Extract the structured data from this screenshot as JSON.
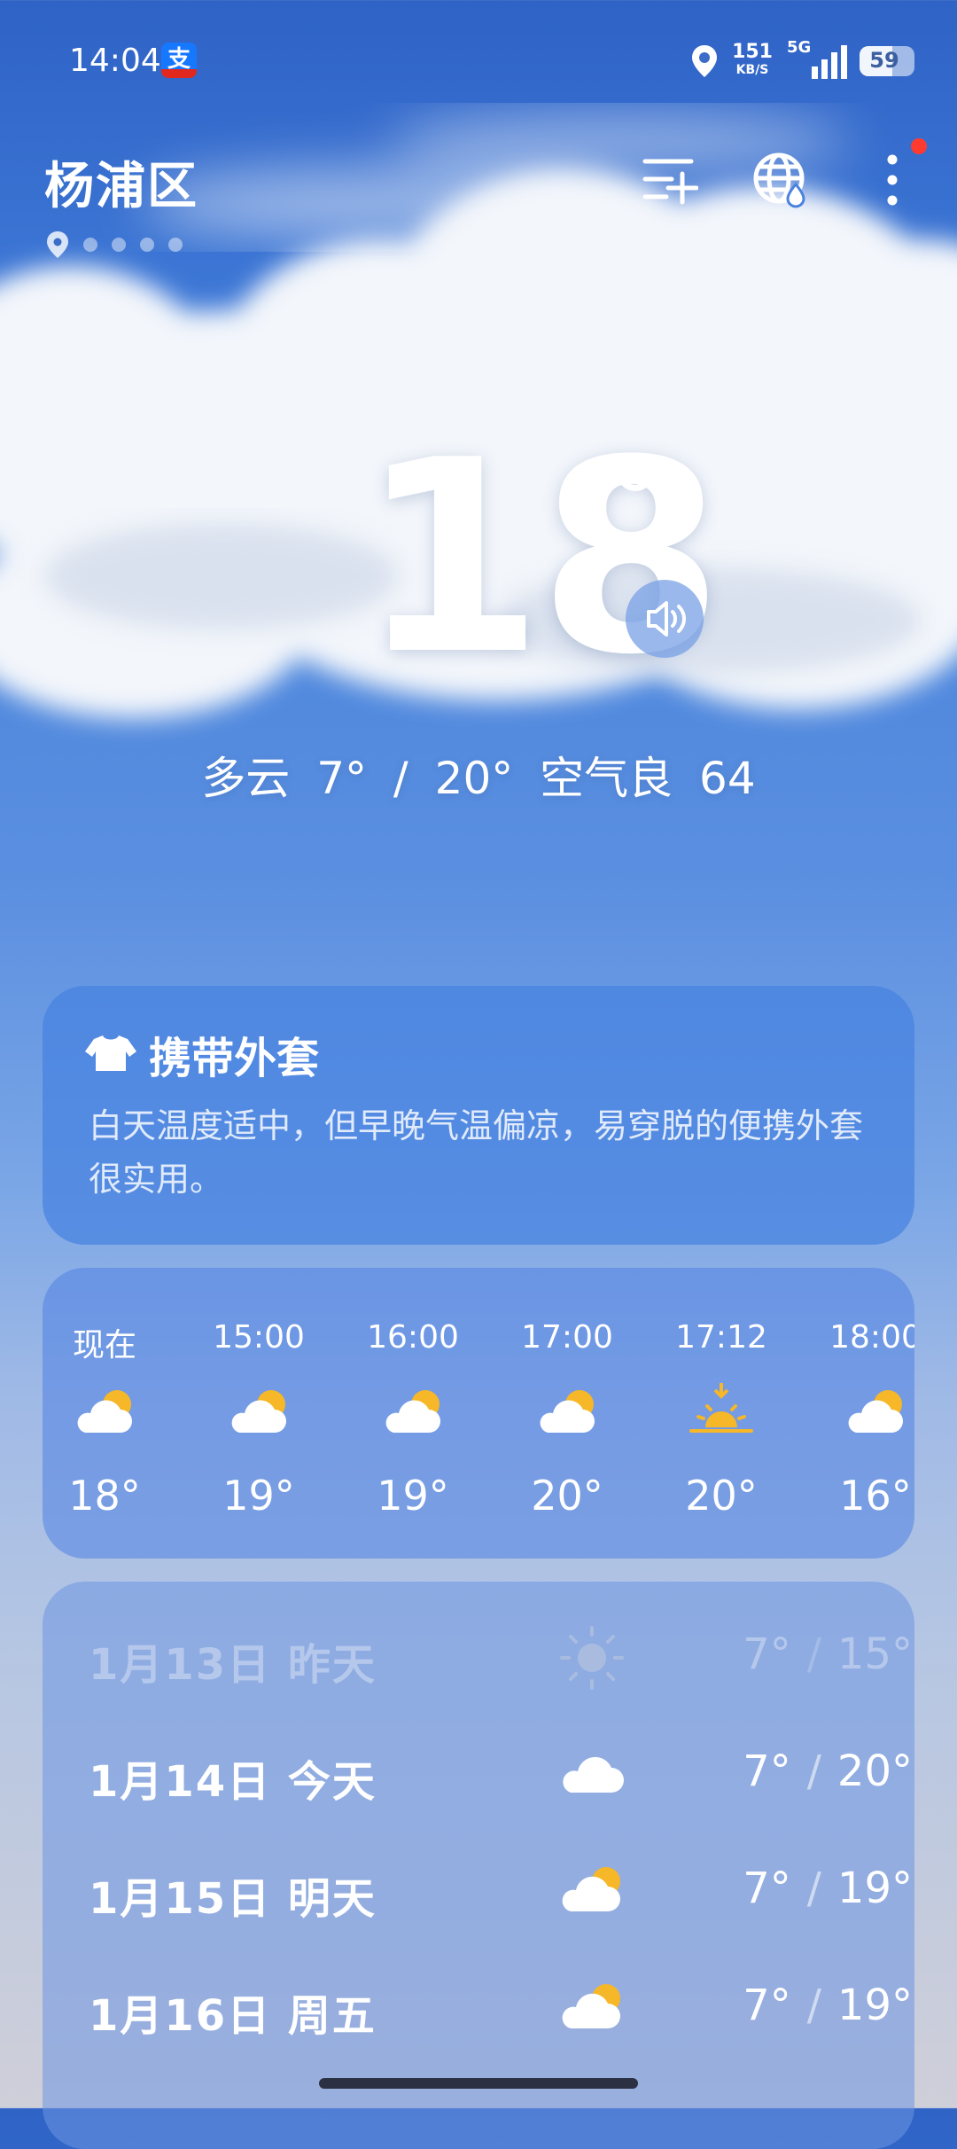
{
  "status_bar": {
    "time": "14:04",
    "app_badge": "支",
    "net_speed_value": "151",
    "net_speed_unit": "KB/S",
    "network_type": "5G",
    "battery": "59"
  },
  "header": {
    "city": "杨浦区"
  },
  "current": {
    "temperature": "18",
    "summary": "多云  7° / 20°  空气良 64"
  },
  "tip": {
    "title": "携带外套",
    "text": "白天温度适中，但早晚气温偏凉，易穿脱的便携外套很实用。"
  },
  "hourly": [
    {
      "time": "现在",
      "icon": "partly-cloudy-icon",
      "temp": "18°"
    },
    {
      "time": "15:00",
      "icon": "partly-cloudy-icon",
      "temp": "19°"
    },
    {
      "time": "16:00",
      "icon": "partly-cloudy-icon",
      "temp": "19°"
    },
    {
      "time": "17:00",
      "icon": "partly-cloudy-icon",
      "temp": "20°"
    },
    {
      "time": "17:12",
      "icon": "sunset-icon",
      "temp": "20°"
    },
    {
      "time": "18:00",
      "icon": "partly-cloudy-icon",
      "temp": "16°"
    }
  ],
  "daily": [
    {
      "date": "1月13日  昨天",
      "icon": "sun-icon",
      "low": "7°",
      "high": "15°"
    },
    {
      "date": "1月14日  今天",
      "icon": "cloud-icon",
      "low": "7°",
      "high": "20°"
    },
    {
      "date": "1月15日  明天",
      "icon": "partly-cloudy-icon",
      "low": "7°",
      "high": "19°"
    },
    {
      "date": "1月16日  周五",
      "icon": "partly-cloudy-icon",
      "low": "7°",
      "high": "19°"
    }
  ],
  "colors": {
    "sun": "#f6b728",
    "card": "#4a82e0"
  }
}
